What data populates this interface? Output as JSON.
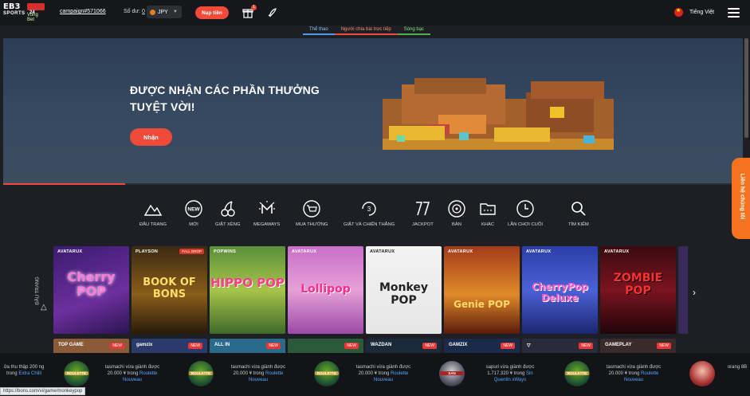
{
  "header": {
    "logo_line1": "EB3",
    "logo_line2": "SPORTS",
    "logo_badge": "24",
    "logo_sub": "Vung Bet",
    "account": "campaign#571066",
    "balance_label": "Số dư:",
    "balance_value": "0",
    "currency": "JPY",
    "deposit_label": "Nạp tiền",
    "gift_count": "1",
    "language": "Tiếng Việt"
  },
  "subtabs": [
    "Thể thao",
    "Người chia bài trực tiếp",
    "Sòng bạc"
  ],
  "banner": {
    "title": "ĐƯỢC NHẬN CÁC PHẦN THƯỞNG TUYỆT VỜI!",
    "button": "Nhận",
    "progress": 0.165
  },
  "categories": [
    {
      "label": "ĐẦU TRANG",
      "icon": "mountain-icon"
    },
    {
      "label": "MỚI",
      "icon": "new-icon"
    },
    {
      "label": "GIẬT XÈNG",
      "icon": "cherry-icon"
    },
    {
      "label": "MEGAWAYS",
      "icon": "megaways-icon"
    },
    {
      "label": "MUA THƯỞNG",
      "icon": "cart-icon"
    },
    {
      "label": "GIẬT VÀ CHIẾN THẮNG",
      "icon": "drop-win-icon"
    },
    {
      "label": "JACKPOT",
      "icon": "jackpot-icon"
    },
    {
      "label": "BÀN",
      "icon": "roulette-icon"
    },
    {
      "label": "KHÁC",
      "icon": "folder-icon"
    },
    {
      "label": "LẦN CHƠI CUỐI",
      "icon": "clock-icon"
    },
    {
      "label": "TÌM KIẾM",
      "icon": "search-icon"
    }
  ],
  "side_label": "ĐẦU TRANG",
  "games": [
    {
      "provider": "AVATARUX",
      "name": "Cherry POP",
      "badge": ""
    },
    {
      "provider": "PLAYSON",
      "name": "BOOK OF BONS",
      "badge": "FALL DROP"
    },
    {
      "provider": "POPWINS",
      "name": "HIPPO POP",
      "badge": ""
    },
    {
      "provider": "AVATARUX",
      "name": "Lollipop",
      "badge": ""
    },
    {
      "provider": "AVATARUX",
      "name": "Monkey POP",
      "badge": ""
    },
    {
      "provider": "AVATARUX",
      "name": "Genie POP",
      "badge": ""
    },
    {
      "provider": "AVATARUX",
      "name": "CherryPop Deluxe",
      "badge": ""
    },
    {
      "provider": "AVATARUX",
      "name": "ZOMBIE POP",
      "badge": ""
    }
  ],
  "row2": [
    {
      "provider": "TOP GAME",
      "badge": "NEW"
    },
    {
      "provider": "gamzix",
      "badge": "NEW"
    },
    {
      "provider": "ALL IN",
      "badge": "NEW"
    },
    {
      "provider": "",
      "badge": "NEW"
    },
    {
      "provider": "WAZDAN",
      "badge": "NEW"
    },
    {
      "provider": "GAMZIX",
      "badge": "NEW"
    },
    {
      "provider": "▽",
      "badge": "NEW"
    },
    {
      "provider": "GAMEPLAY",
      "badge": "NEW"
    }
  ],
  "winners": [
    {
      "text": "ửa thu thập 200 ng trong",
      "game": "Extra Chilli",
      "icon": "ROULETTE"
    },
    {
      "text": "tasmachi vừa giành được 20.000 ¥ trong",
      "game": "Roulette Nouveau",
      "icon": "ROULETTE"
    },
    {
      "text": "tasmachi vừa giành được 20.000 ¥ trong",
      "game": "Roulette Nouveau",
      "icon": "ROULETTE"
    },
    {
      "text": "tasmachi vừa giành được 20.000 ¥ trong",
      "game": "Roulette Nouveau",
      "icon": "ROULETTE"
    },
    {
      "text": "sapuri vừa giành được 1.717.320 ¥ trong",
      "game": "Sin Quentin xWays",
      "icon": "SAN"
    },
    {
      "text": "tasmachi vừa giành được 20.000 ¥ trong",
      "game": "Roulette Nouveau",
      "icon": "ROULETTE"
    },
    {
      "text": "orang 8B",
      "game": "",
      "icon": ""
    }
  ],
  "status_url": "https://bons.com/vi/game/monkeypop",
  "contact": "Liên hệ chúng tôi",
  "colors": {
    "accent": "#ef4a3a",
    "contact": "#f5731e",
    "link": "#55a7ff"
  }
}
